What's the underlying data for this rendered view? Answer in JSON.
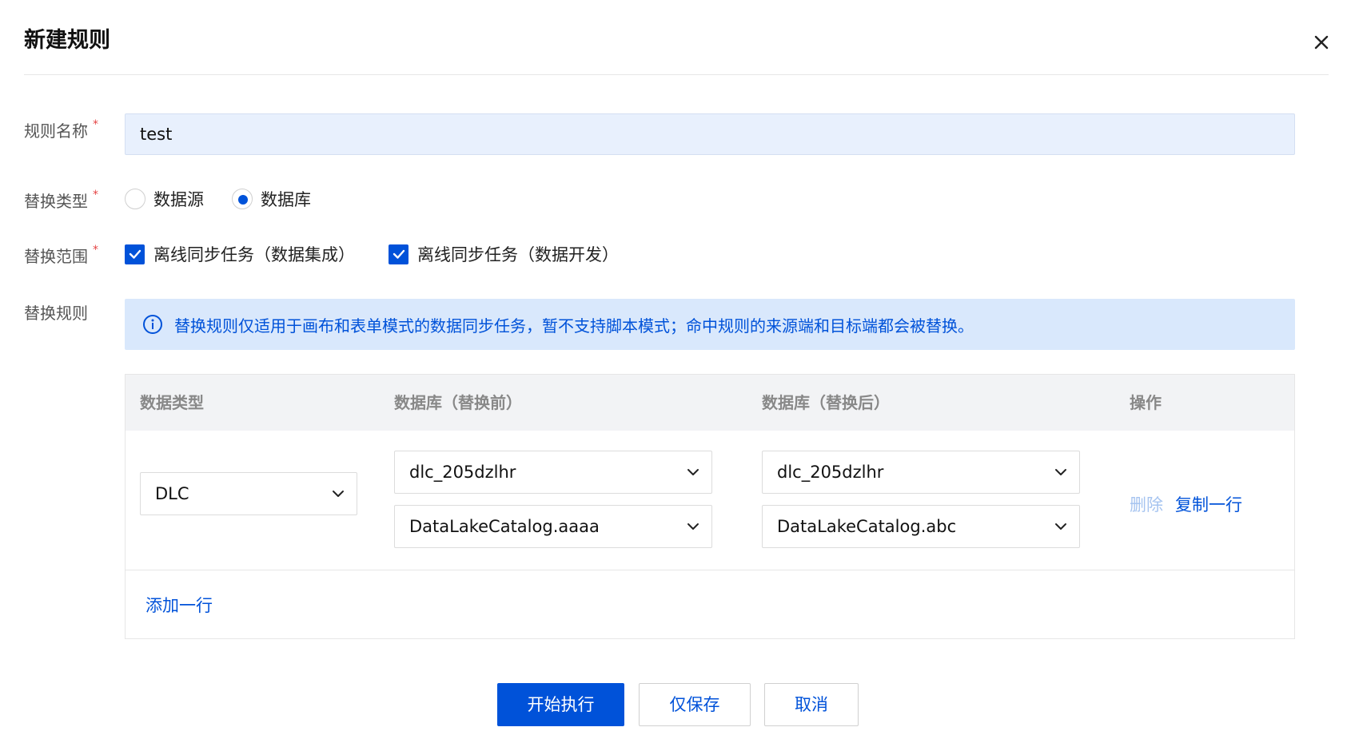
{
  "dialog": {
    "title": "新建规则"
  },
  "form": {
    "name": {
      "label": "规则名称",
      "required_mark": "*",
      "value": "test"
    },
    "type": {
      "label": "替换类型",
      "required_mark": "*",
      "options": [
        {
          "label": "数据源",
          "selected": false
        },
        {
          "label": "数据库",
          "selected": true
        }
      ]
    },
    "scope": {
      "label": "替换范围",
      "required_mark": "*",
      "options": [
        {
          "label": "离线同步任务（数据集成）",
          "checked": true
        },
        {
          "label": "离线同步任务（数据开发）",
          "checked": true
        }
      ]
    },
    "rules": {
      "label": "替换规则",
      "info": "替换规则仅适用于画布和表单模式的数据同步任务，暂不支持脚本模式；命中规则的来源端和目标端都会被替换。"
    }
  },
  "table": {
    "columns": [
      "数据类型",
      "数据库（替换前）",
      "数据库（替换后）",
      "操作"
    ],
    "rows": [
      {
        "data_type": "DLC",
        "before": [
          "dlc_205dzlhr",
          "DataLakeCatalog.aaaa"
        ],
        "after": [
          "dlc_205dzlhr",
          "DataLakeCatalog.abc"
        ],
        "actions": {
          "delete": "删除",
          "copy": "复制一行"
        }
      }
    ],
    "add_row": "添加一行"
  },
  "footer": {
    "start": "开始执行",
    "save": "仅保存",
    "cancel": "取消"
  },
  "colors": {
    "accent": "#0052d9",
    "info_bg": "#d9e8fc",
    "input_bg": "#e8f0fd",
    "required": "#e54545"
  }
}
